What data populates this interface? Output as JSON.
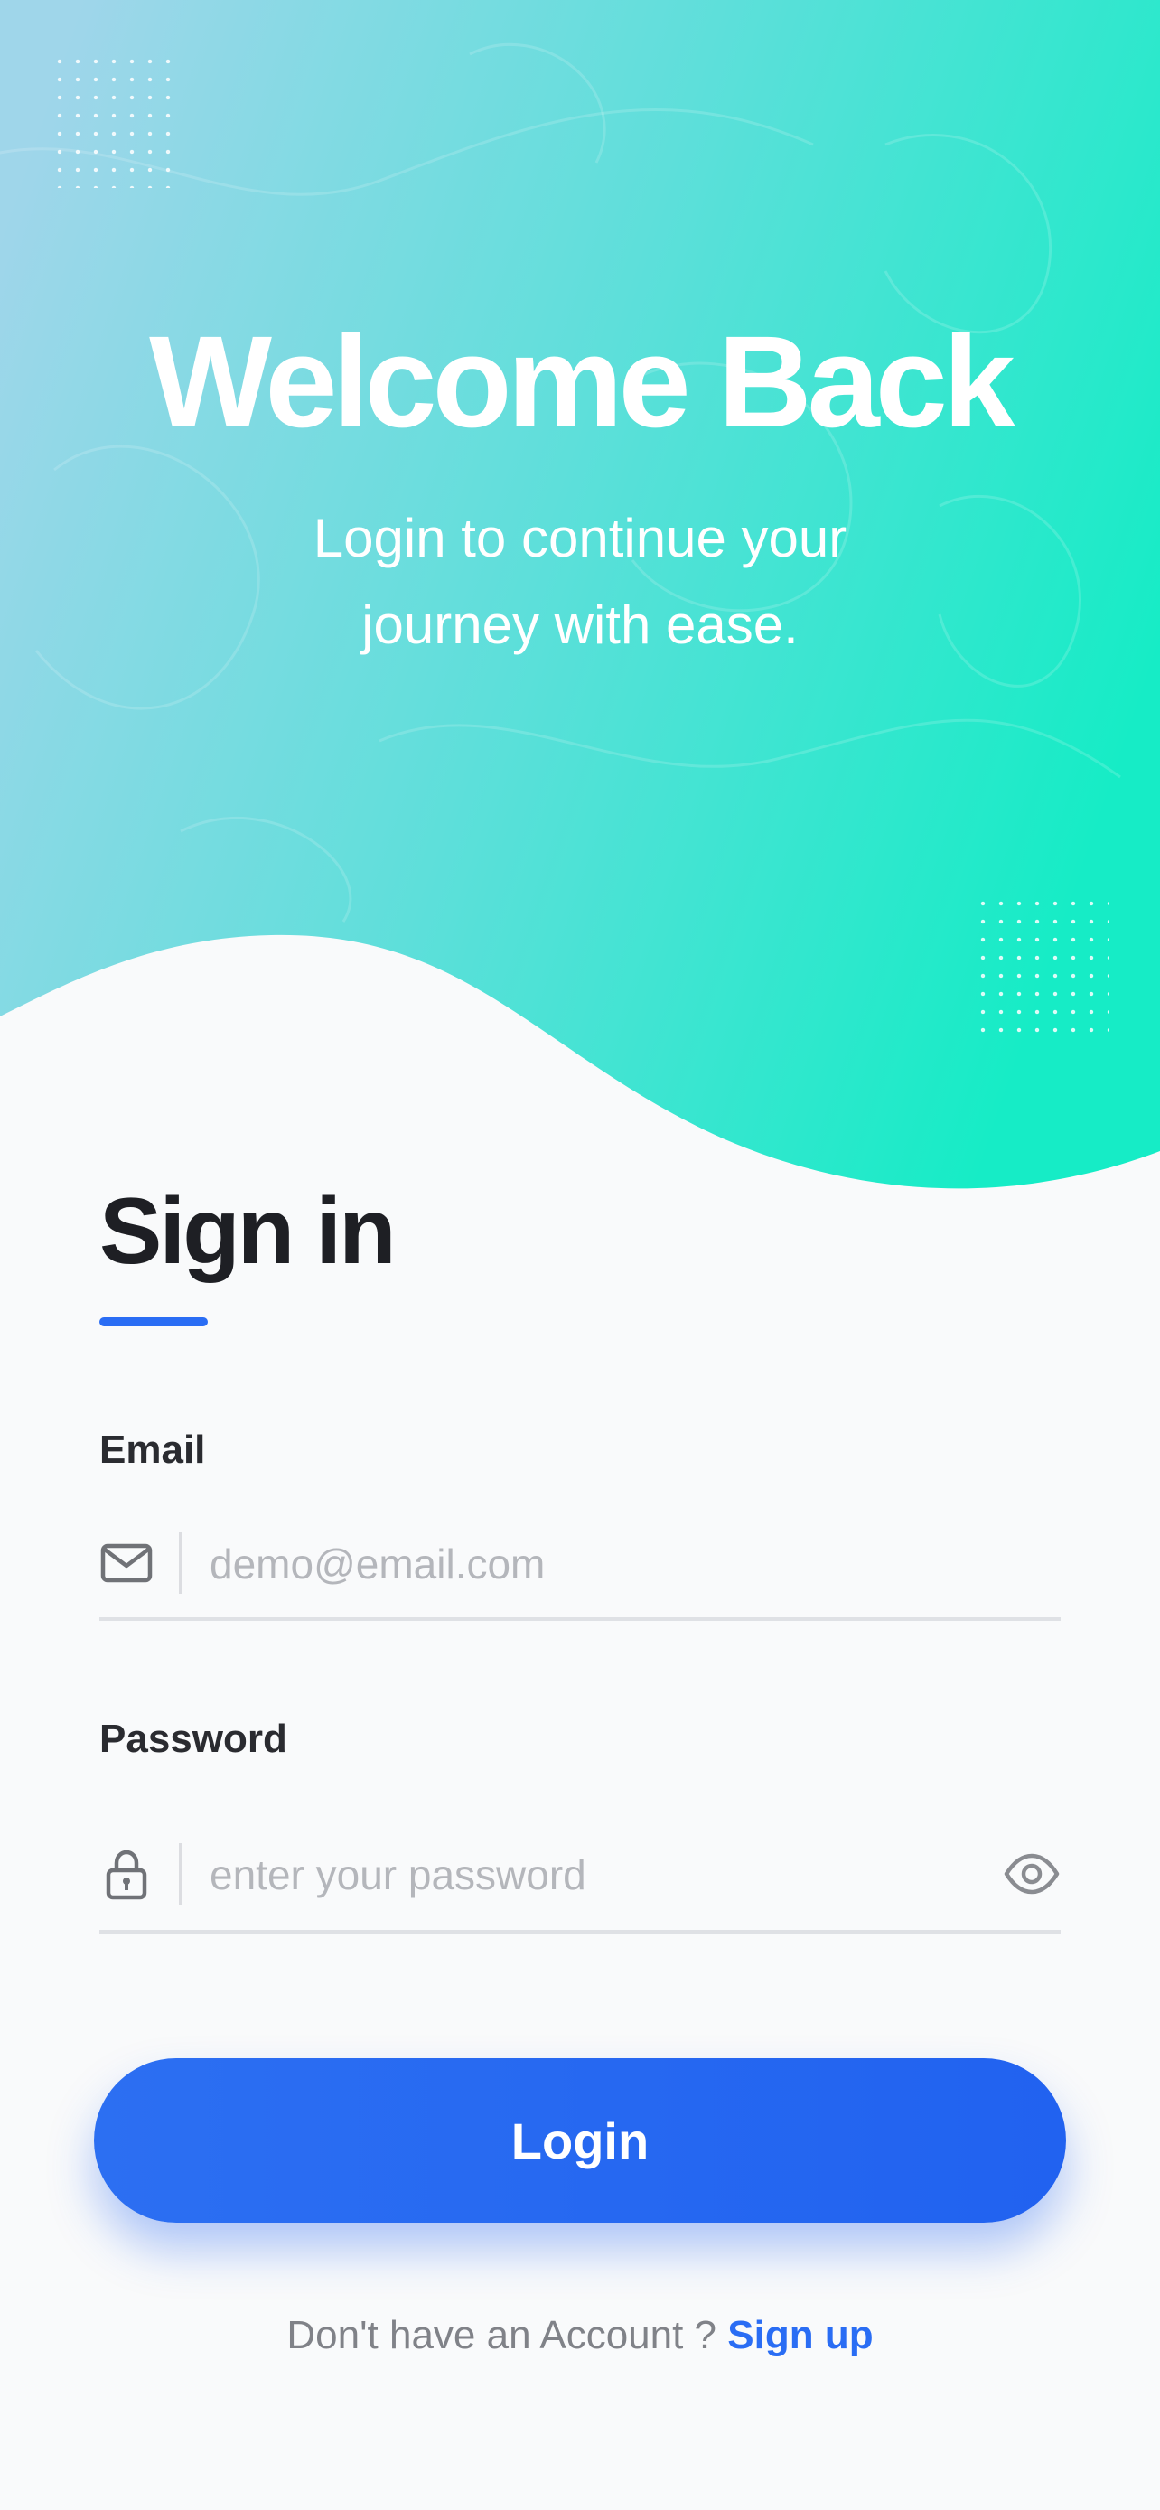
{
  "hero": {
    "title": "Welcome Back",
    "subtitle": "Login to continue your journey with ease."
  },
  "signin": {
    "title": "Sign in"
  },
  "email": {
    "label": "Email",
    "placeholder": "demo@email.com",
    "value": "",
    "icon": "mail-icon"
  },
  "password": {
    "label": "Password",
    "placeholder": "enter your password",
    "value": "",
    "icon": "lock-icon",
    "toggle_icon": "eye-icon"
  },
  "login_button": {
    "label": "Login"
  },
  "footer": {
    "prompt": "Don't have an Account ?",
    "signup_link": "Sign up"
  },
  "colors": {
    "accent": "#2a6df4",
    "hero_gradient_start": "#9fd6ea",
    "hero_gradient_end": "#16ecc6",
    "background": "#f9fafb"
  }
}
